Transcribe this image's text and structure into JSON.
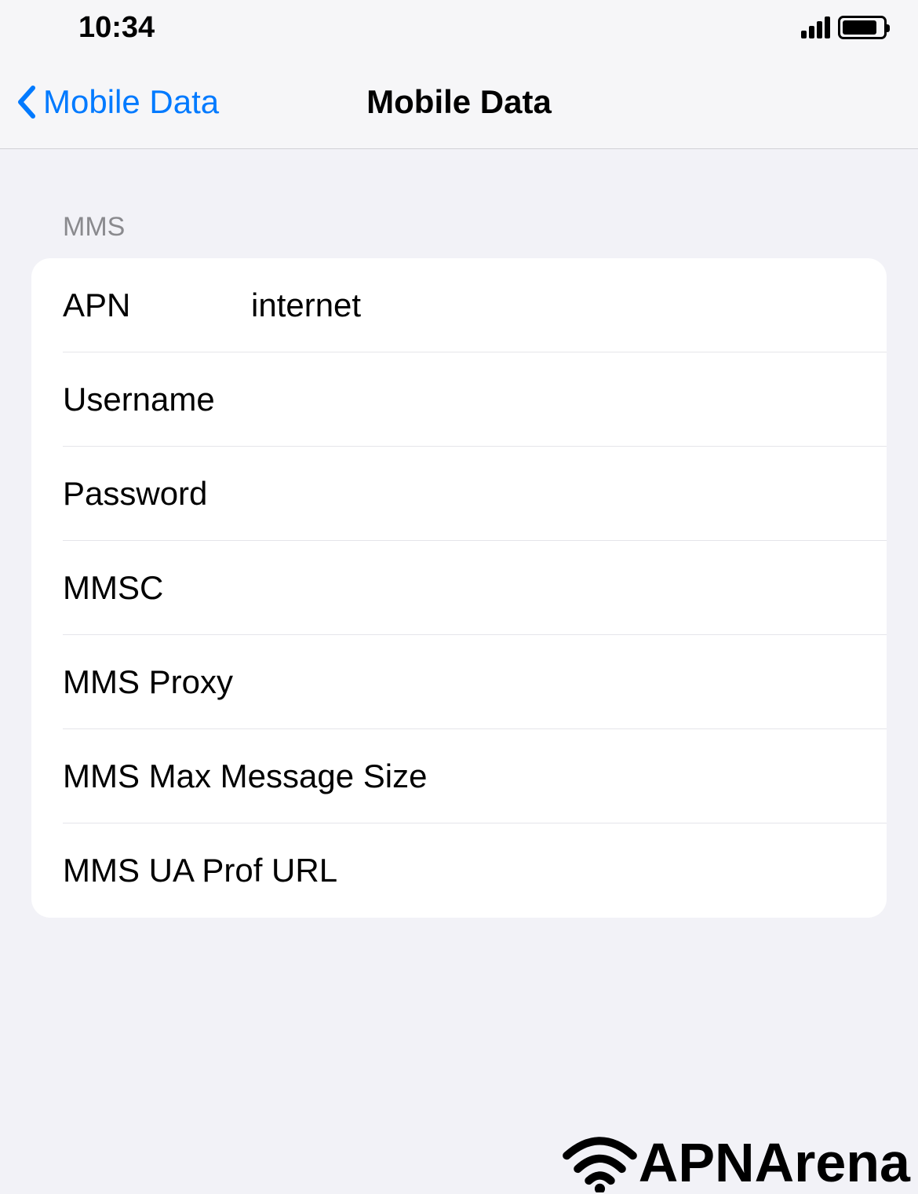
{
  "status_bar": {
    "time": "10:34"
  },
  "nav": {
    "back_label": "Mobile Data",
    "title": "Mobile Data"
  },
  "section": {
    "header": "MMS",
    "rows": [
      {
        "label": "APN",
        "value": "internet"
      },
      {
        "label": "Username",
        "value": ""
      },
      {
        "label": "Password",
        "value": ""
      },
      {
        "label": "MMSC",
        "value": ""
      },
      {
        "label": "MMS Proxy",
        "value": ""
      },
      {
        "label": "MMS Max Message Size",
        "value": ""
      },
      {
        "label": "MMS UA Prof URL",
        "value": ""
      }
    ]
  },
  "watermark": "APNArena",
  "brand": "APNArena"
}
